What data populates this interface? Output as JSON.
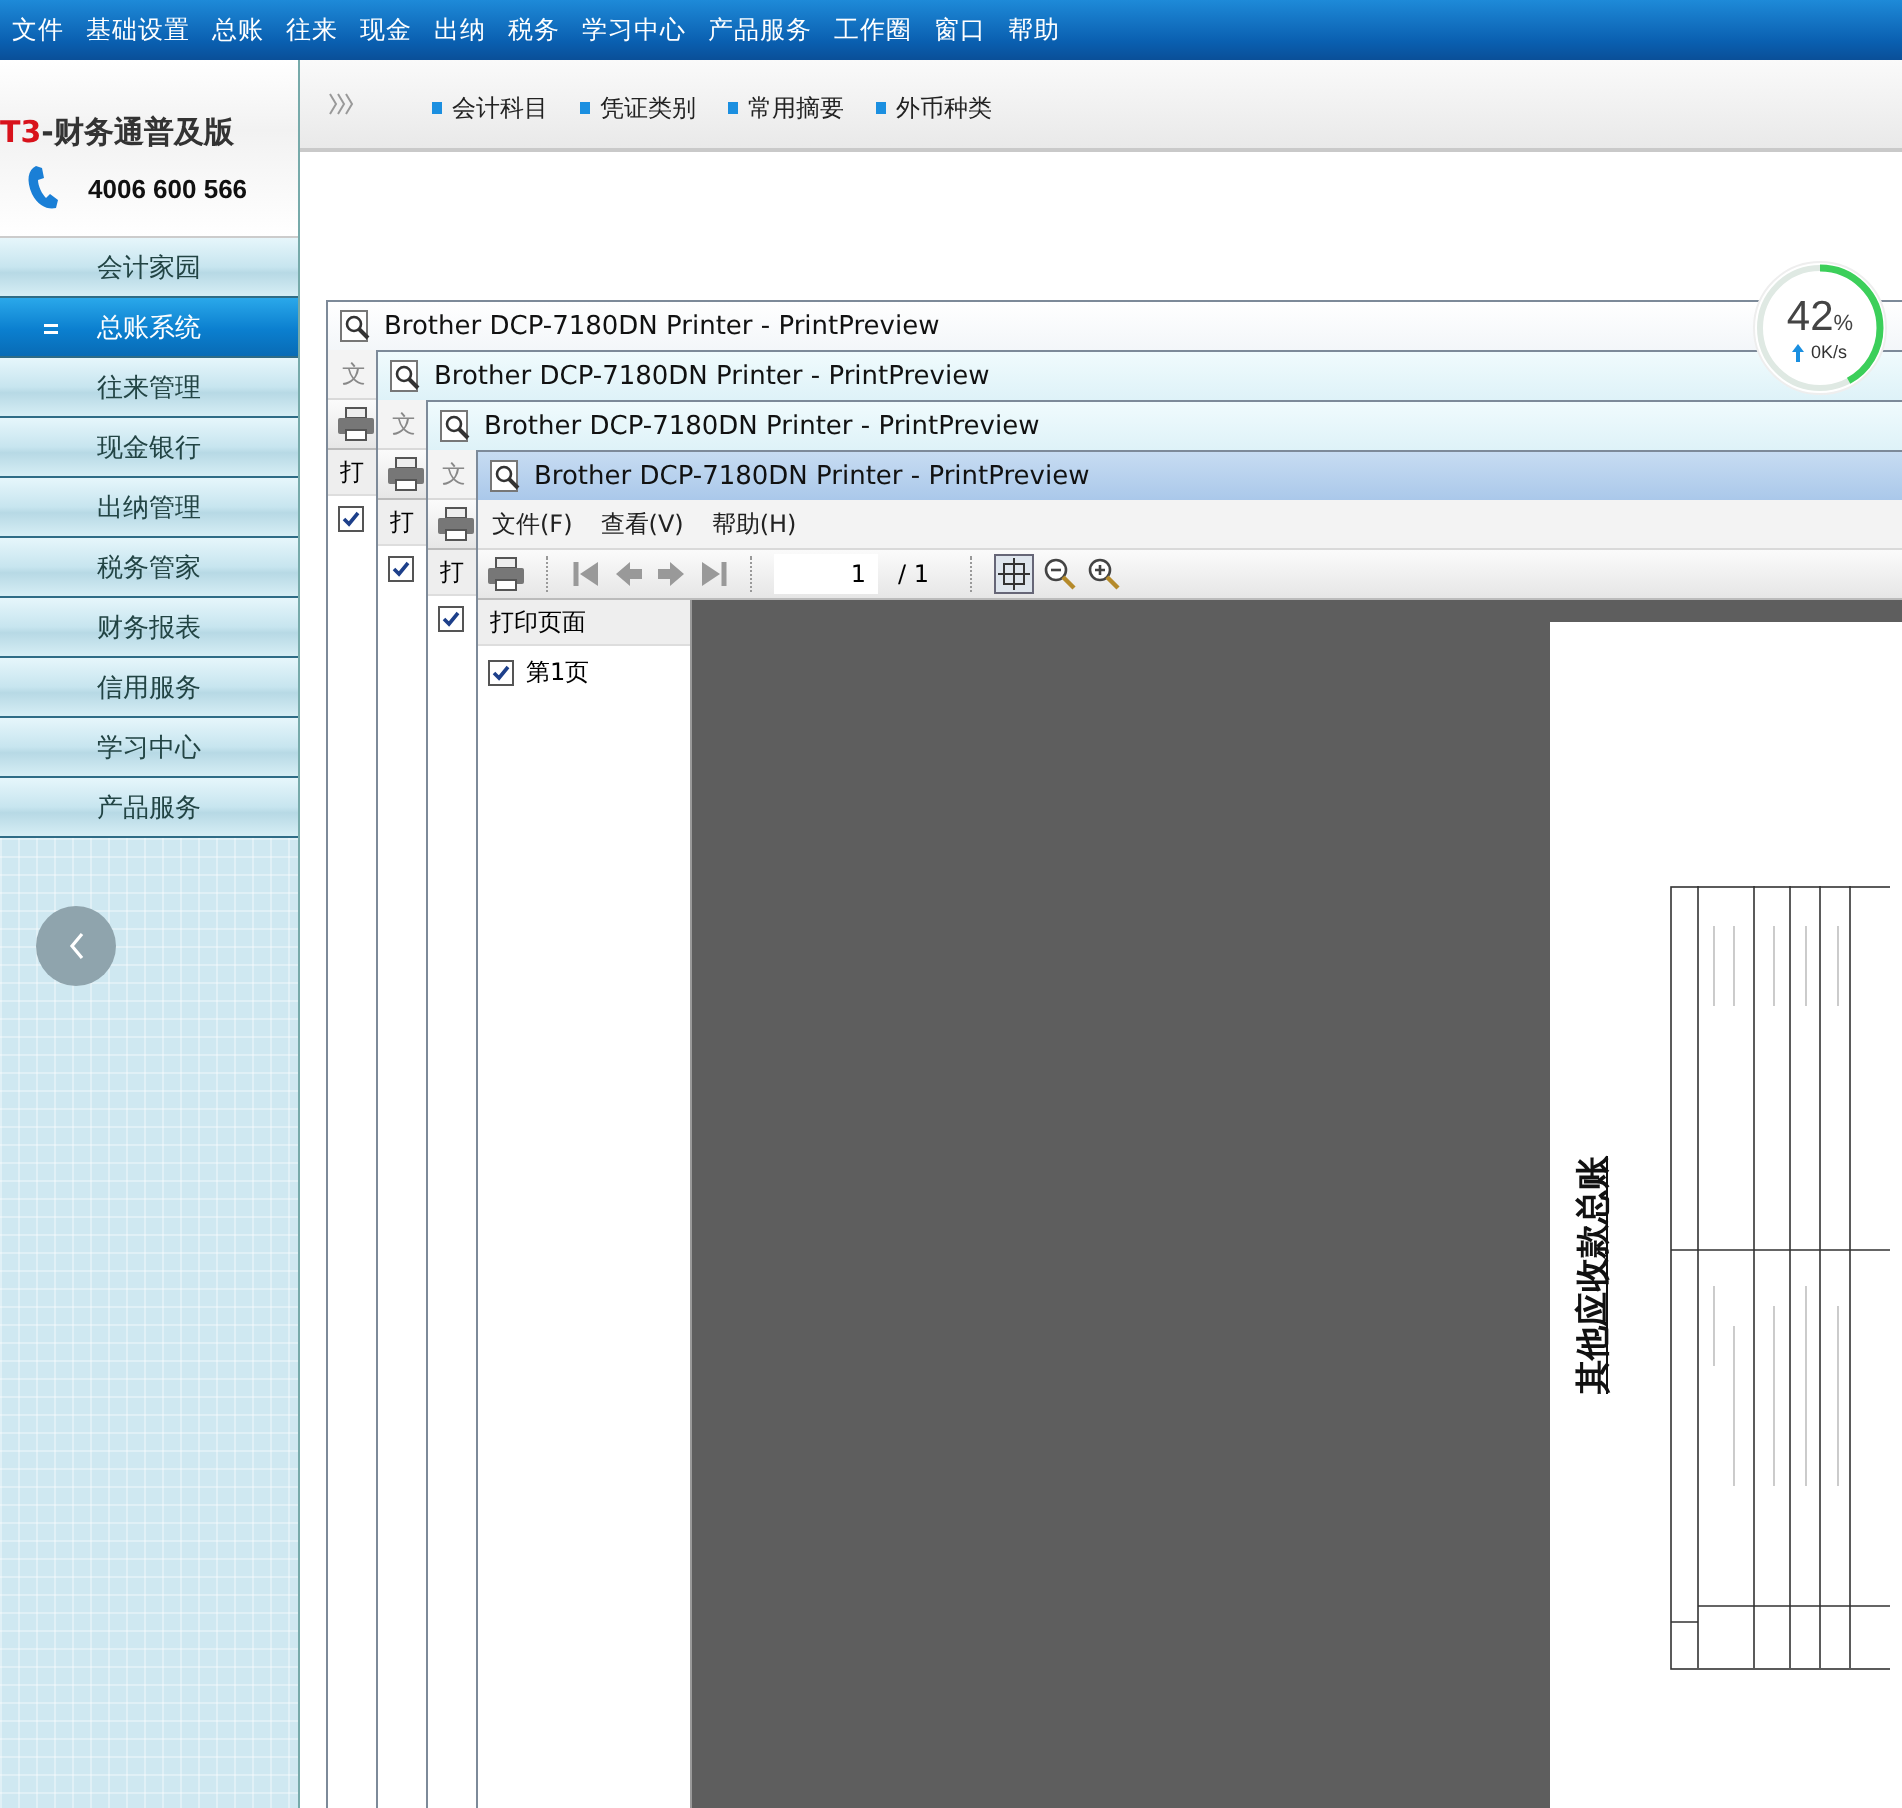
{
  "menu_bar": {
    "items": [
      "文件",
      "基础设置",
      "总账",
      "往来",
      "现金",
      "出纳",
      "税务",
      "学习中心",
      "产品服务",
      "工作圈",
      "窗口",
      "帮助"
    ]
  },
  "logo": {
    "brand": "T3",
    "product": "-财务通普及版",
    "phone": "4006 600 566"
  },
  "sidebar": {
    "items": [
      {
        "label": "会计家园",
        "selected": false
      },
      {
        "label": "总账系统",
        "selected": true
      },
      {
        "label": "往来管理",
        "selected": false
      },
      {
        "label": "现金银行",
        "selected": false
      },
      {
        "label": "出纳管理",
        "selected": false
      },
      {
        "label": "税务管家",
        "selected": false
      },
      {
        "label": "财务报表",
        "selected": false
      },
      {
        "label": "信用服务",
        "selected": false
      },
      {
        "label": "学习中心",
        "selected": false
      },
      {
        "label": "产品服务",
        "selected": false
      }
    ]
  },
  "shortcut_bar": {
    "items": [
      "会计科目",
      "凭证类别",
      "常用摘要",
      "外币种类"
    ]
  },
  "speed_gauge": {
    "value": "42",
    "unit": "%",
    "level": 0.42,
    "speed": "0K/s"
  },
  "background_windows": [
    {
      "title": "Brother DCP-7180DN Printer - PrintPreview",
      "menu_fragment": "文",
      "panel_fragment": "打",
      "page_checked": true
    },
    {
      "title": "Brother DCP-7180DN Printer - PrintPreview",
      "menu_fragment": "文",
      "panel_fragment": "打",
      "page_checked": true
    },
    {
      "title": "Brother DCP-7180DN Printer - PrintPreview",
      "menu_fragment": "文",
      "panel_fragment": "打",
      "page_checked": true
    }
  ],
  "preview_window": {
    "title": "Brother DCP-7180DN Printer - PrintPreview",
    "menu": [
      "文件(F)",
      "查看(V)",
      "帮助(H)"
    ],
    "page_number": "1",
    "page_total": "/ 1",
    "pages_header": "打印页面",
    "pages": [
      {
        "label": "第1页",
        "checked": true
      }
    ],
    "page_title": "其他应收款总账"
  }
}
